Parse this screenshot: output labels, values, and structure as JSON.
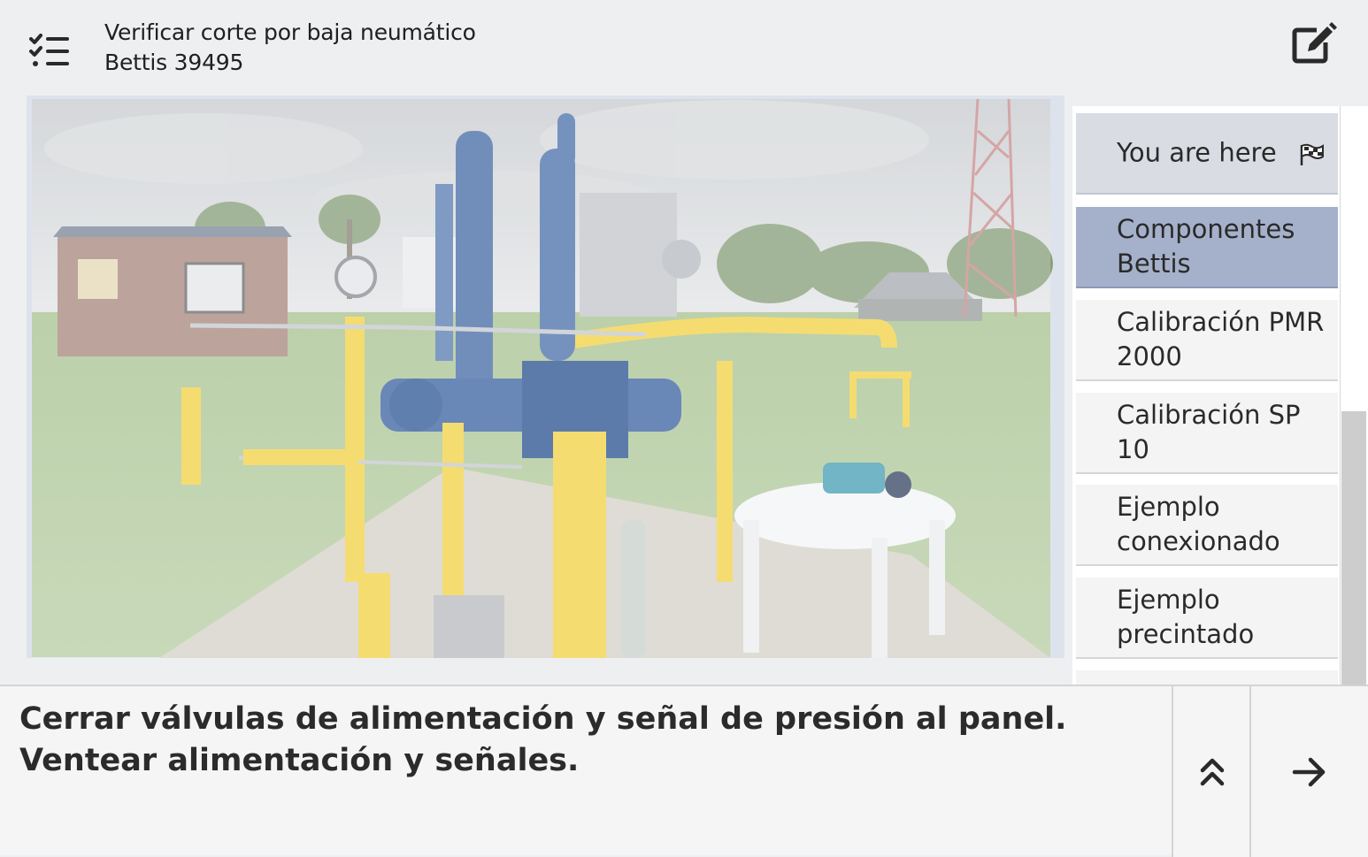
{
  "header": {
    "title_line1": "Verificar corte por baja neumático",
    "title_line2": "Bettis 39495",
    "menu_icon": "checklist-icon",
    "edit_icon": "edit-icon"
  },
  "image": {
    "content": "photo-gas-valve-station"
  },
  "nav": {
    "items": [
      {
        "label": "You are here",
        "state": "current"
      },
      {
        "label": "Componentes Bettis",
        "state": "selected"
      },
      {
        "label": "Calibración PMR 2000",
        "state": "normal"
      },
      {
        "label": "Calibración SP 10",
        "state": "normal"
      },
      {
        "label": "Ejemplo conexionado",
        "state": "normal"
      },
      {
        "label": "Ejemplo precintado",
        "state": "normal"
      },
      {
        "label": "",
        "state": "normal"
      }
    ],
    "flag_icon": "checkered-flag-icon"
  },
  "footer": {
    "instruction": "Cerrar válvulas de alimentación y señal de presión al panel. Ventear alimentación y señales.",
    "collapse_icon": "double-chevron-up-icon",
    "next_icon": "arrow-right-icon"
  },
  "colors": {
    "background": "#eeeff1",
    "selected_item": "#a5b1cb",
    "current_item": "#d9dce3",
    "pipe_yellow": "#f2d24a",
    "tank_blue": "#4a6fa8"
  }
}
